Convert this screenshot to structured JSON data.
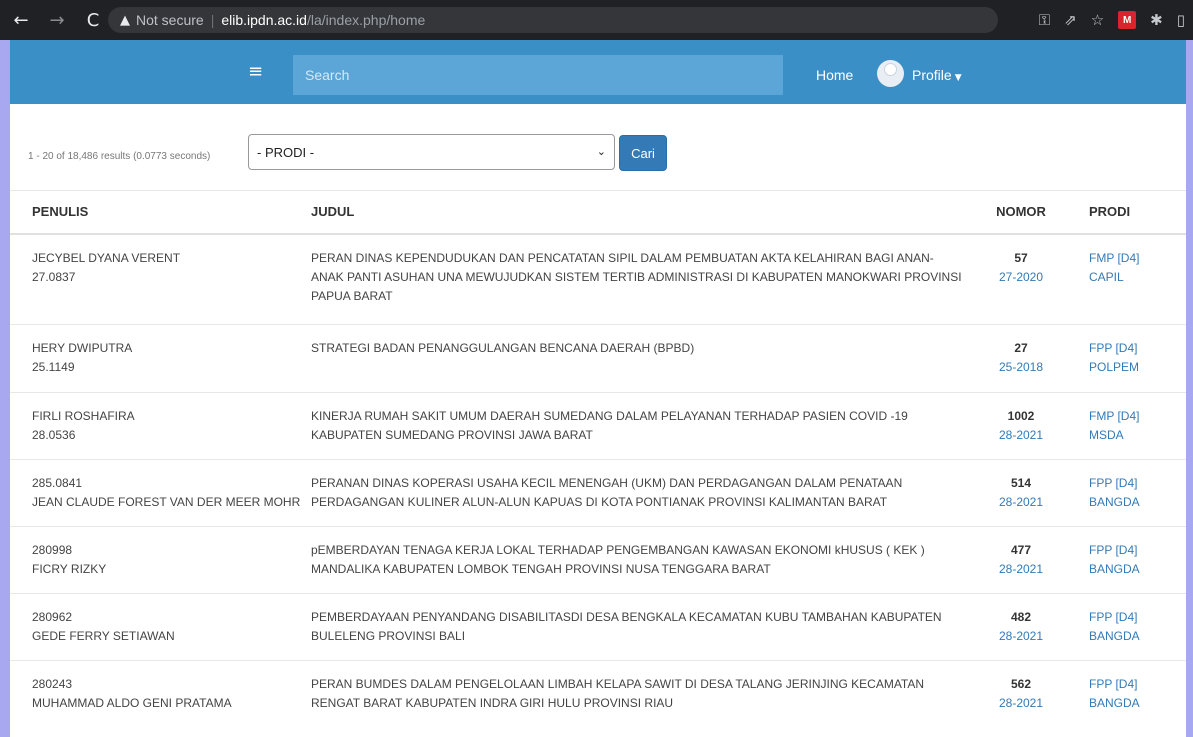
{
  "browser": {
    "warning": "Not secure",
    "host": "elib.ipdn.ac.id",
    "path": "/la/index.php/home"
  },
  "navbar": {
    "search_placeholder": "Search",
    "home_label": "Home",
    "profile_label": "Profile"
  },
  "filter": {
    "result_count": "1 - 20 of 18,486 results (0.0773 seconds)",
    "select_value": "- PRODI -",
    "submit_label": "Cari"
  },
  "table": {
    "headers": [
      "PENULIS",
      "JUDUL",
      "NOMOR",
      "PRODI"
    ],
    "rows": [
      {
        "penulis1": "JECYBEL DYANA VERENT",
        "penulis2": "27.0837",
        "judul": "PERAN DINAS KEPENDUDUKAN DAN PENCATATAN SIPIL DALAM PEMBUATAN AKTA KELAHIRAN BAGI ANAN-ANAK PANTI ASUHAN UNA MEWUJUDKAN SISTEM TERTIB ADMINISTRASI DI KABUPATEN MANOKWARI PROVINSI PAPUA BARAT",
        "nomor": "57",
        "kode": "27-2020",
        "fakultas": "FMP [D4]",
        "prodi": "CAPIL"
      },
      {
        "penulis1": "HERY DWIPUTRA",
        "penulis2": "25.1149",
        "judul": "STRATEGI BADAN PENANGGULANGAN BENCANA DAERAH (BPBD)",
        "nomor": "27",
        "kode": "25-2018",
        "fakultas": "FPP [D4]",
        "prodi": "POLPEM"
      },
      {
        "penulis1": "FIRLI ROSHAFIRA",
        "penulis2": "28.0536",
        "judul": "KINERJA RUMAH SAKIT UMUM DAERAH SUMEDANG DALAM PELAYANAN TERHADAP PASIEN COVID -19 KABUPATEN SUMEDANG PROVINSI JAWA BARAT",
        "nomor": "1002",
        "kode": "28-2021",
        "fakultas": "FMP [D4]",
        "prodi": "MSDA"
      },
      {
        "penulis1": "285.0841",
        "penulis2": "JEAN CLAUDE FOREST VAN DER MEER MOHR",
        "judul": "PERANAN DINAS KOPERASI USAHA KECIL MENENGAH (UKM) DAN PERDAGANGAN DALAM PENATAAN PERDAGANGAN KULINER ALUN-ALUN KAPUAS DI KOTA PONTIANAK PROVINSI KALIMANTAN BARAT",
        "nomor": "514",
        "kode": "28-2021",
        "fakultas": "FPP [D4]",
        "prodi": "BANGDA"
      },
      {
        "penulis1": "280998",
        "penulis2": "FICRY RIZKY",
        "judul": "pEMBERDAYAN TENAGA KERJA LOKAL TERHADAP PENGEMBANGAN KAWASAN EKONOMI kHUSUS ( KEK ) MANDALIKA KABUPATEN LOMBOK TENGAH PROVINSI NUSA TENGGARA BARAT",
        "nomor": "477",
        "kode": "28-2021",
        "fakultas": "FPP [D4]",
        "prodi": "BANGDA"
      },
      {
        "penulis1": "280962",
        "penulis2": "GEDE FERRY SETIAWAN",
        "judul": "PEMBERDAYAAN PENYANDANG DISABILITASDI DESA BENGKALA KECAMATAN KUBU TAMBAHAN KABUPATEN BULELENG PROVINSI BALI",
        "nomor": "482",
        "kode": "28-2021",
        "fakultas": "FPP [D4]",
        "prodi": "BANGDA"
      },
      {
        "penulis1": "280243",
        "penulis2": "MUHAMMAD ALDO GENI PRATAMA",
        "judul": "PERAN BUMDES DALAM PENGELOLAAN LIMBAH KELAPA SAWIT DI DESA TALANG JERINJING KECAMATAN RENGAT BARAT KABUPATEN INDRA GIRI HULU PROVINSI RIAU",
        "nomor": "562",
        "kode": "28-2021",
        "fakultas": "FPP [D4]",
        "prodi": "BANGDA"
      }
    ]
  }
}
